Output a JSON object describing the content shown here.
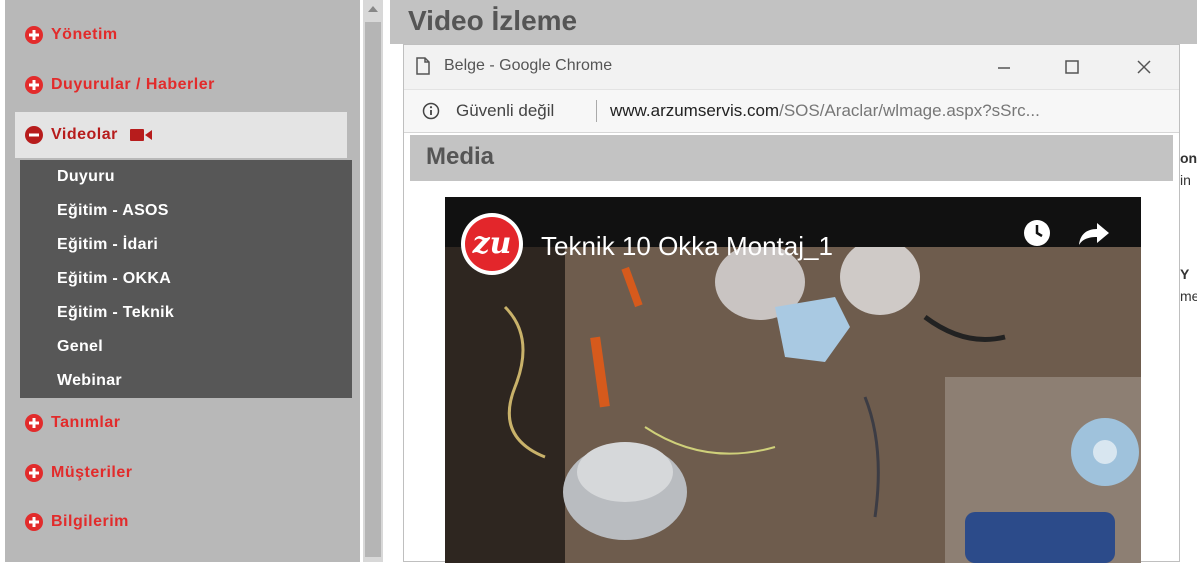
{
  "sidebar": {
    "menu": [
      {
        "label": "Yönetim",
        "expanded": false
      },
      {
        "label": "Duyurular / Haberler",
        "expanded": false
      },
      {
        "label": "Videolar",
        "expanded": true,
        "icon": "video-camera-icon"
      },
      {
        "label": "Tanımlar",
        "expanded": false
      },
      {
        "label": "Müşteriler",
        "expanded": false
      },
      {
        "label": "Bilgilerim",
        "expanded": false
      }
    ],
    "submenu": [
      "Duyuru",
      "Eğitim - ASOS",
      "Eğitim - İdari",
      "Eğitim - OKKA",
      "Eğitim - Teknik",
      "Genel",
      "Webinar"
    ]
  },
  "main": {
    "title": "Video İzleme",
    "partial_text": [
      "on",
      "in",
      "Y",
      "me"
    ]
  },
  "popup": {
    "window_title": "Belge - Google Chrome",
    "security_label": "Güvenli değil",
    "url_host": "www.arzumservis.com",
    "url_path": "/SOS/Araclar/wlmage.aspx?sSrc...",
    "section_title": "Media",
    "video": {
      "title": "Teknik 10 Okka Montaj_1",
      "channel_logo_text": "zu"
    }
  },
  "colors": {
    "accent_red": "#e22b2b",
    "active_red": "#b71c1c",
    "submenu_bg": "#575757",
    "sidebar_bg": "#b8b8b8"
  }
}
